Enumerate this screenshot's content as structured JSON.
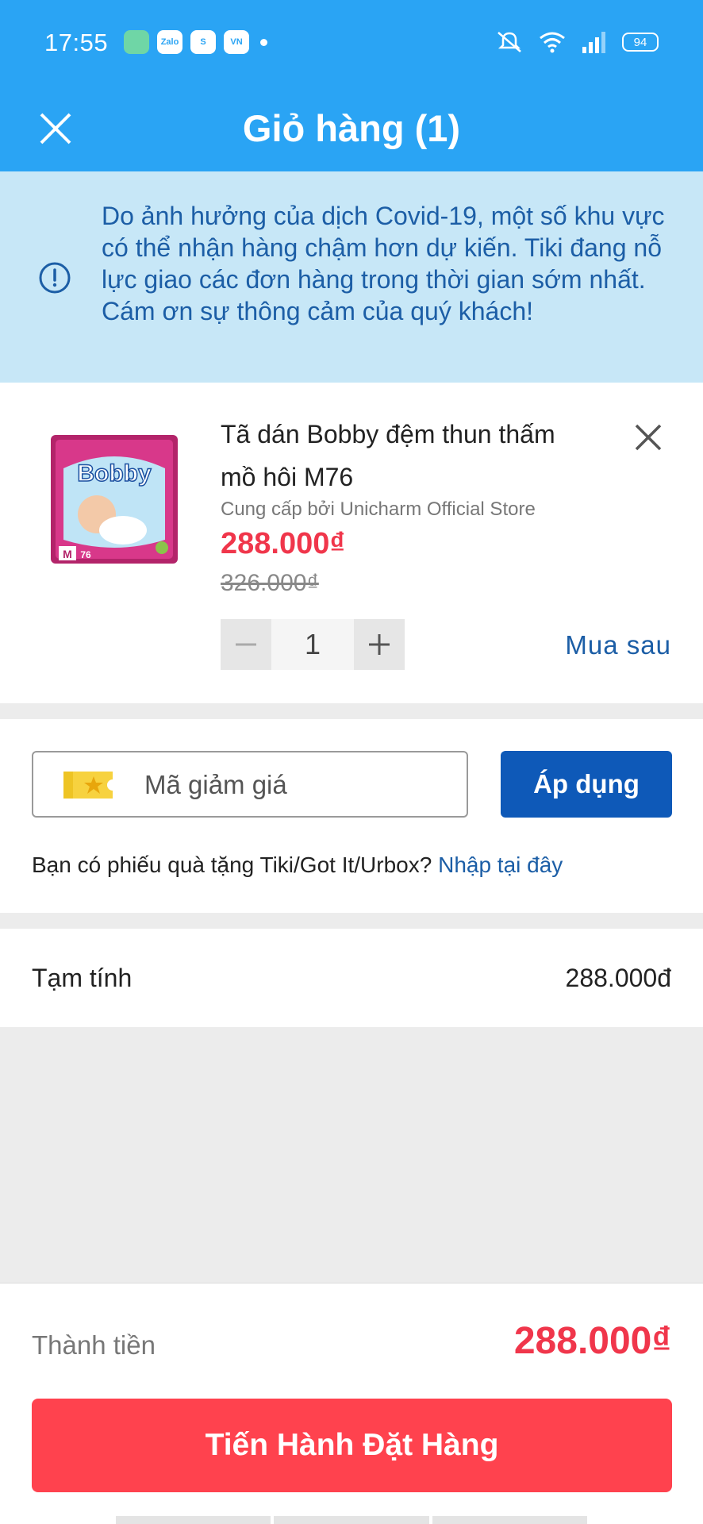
{
  "status_bar": {
    "time": "17:55",
    "apps": [
      "messages",
      "Zalo",
      "shopee",
      "VN"
    ],
    "battery": "94"
  },
  "header": {
    "title": "Giỏ hàng (1)"
  },
  "notice": {
    "text": "Do ảnh hưởng của dịch Covid-19, một số khu vực có thể nhận hàng chậm hơn dự kiến. Tiki đang nỗ lực giao các đơn hàng trong thời gian sớm nhất. Cám ơn sự thông cảm của quý khách!"
  },
  "product": {
    "name": "Tã dán Bobby đệm thun thấm mồ hôi M76",
    "store": "Cung cấp bởi Unicharm Official Store",
    "price": "288.000₫",
    "old_price": "326.000₫",
    "quantity": "1",
    "buy_later": "Mua sau",
    "image_brand": "Bobby",
    "image_size": "M",
    "image_count": "76"
  },
  "coupon": {
    "placeholder": "Mã giảm giá",
    "apply_label": "Áp dụng",
    "gift_question": "Bạn có phiếu quà tặng Tiki/Got It/Urbox?",
    "gift_link": "Nhập tại đây"
  },
  "subtotal": {
    "label": "Tạm tính",
    "value": "288.000đ"
  },
  "total": {
    "label": "Thành tiền",
    "value": "288.000₫"
  },
  "checkout": {
    "label": "Tiến Hành Đặt Hàng"
  },
  "colors": {
    "primary": "#2aa4f4",
    "notice_bg": "#c7e7f7",
    "link": "#1c5ea6",
    "price": "#f0364b",
    "apply": "#0e59b8",
    "checkout": "#ff424e"
  }
}
